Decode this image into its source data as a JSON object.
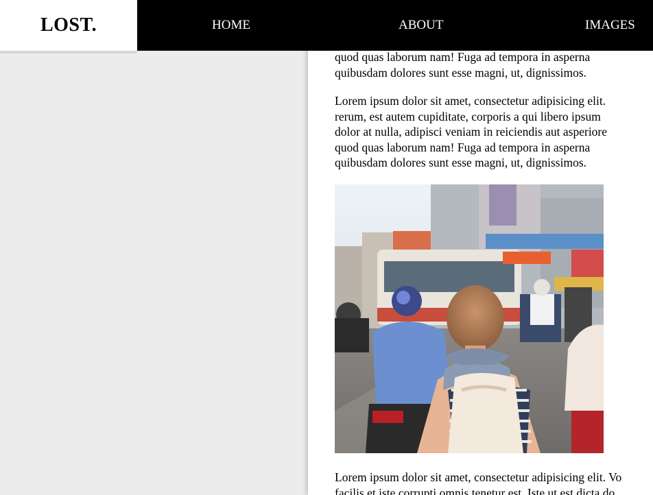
{
  "header": {
    "logo": "LOST.",
    "nav": [
      {
        "label": "HOME"
      },
      {
        "label": "ABOUT"
      },
      {
        "label": "IMAGES"
      }
    ]
  },
  "content": {
    "paragraph_top_lines": [
      "quod quas laborum nam! Fuga ad tempora in asperna",
      "quibusdam dolores sunt esse magni, ut, dignissimos."
    ],
    "paragraph_mid_lines": [
      "Lorem ipsum dolor sit amet, consectetur adipisicing elit.",
      "rerum, est autem cupiditate, corporis a qui libero ipsum",
      "dolor at nulla, adipisci veniam in reiciendis aut asperiore",
      "quod quas laborum nam! Fuga ad tempora in asperna",
      "quibusdam dolores sunt esse magni, ut, dignissimos."
    ],
    "paragraph_bottom_lines": [
      "Lorem ipsum dolor sit amet, consectetur adipisicing elit. Vo",
      "facilis et iste corrupti omnis tenetur est. Iste ut est dicta do"
    ]
  },
  "colors": {
    "header_bg": "#000000",
    "page_bg": "#ececec",
    "content_bg": "#ffffff"
  }
}
